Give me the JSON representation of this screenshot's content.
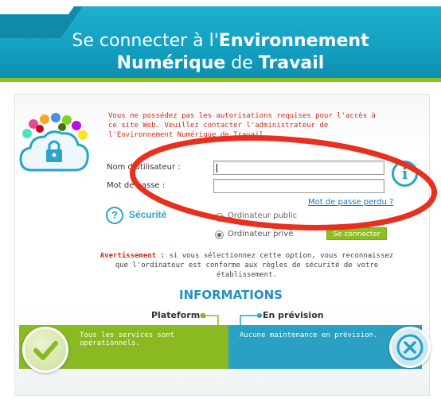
{
  "header": {
    "title_line1_plain": "Se connecter à l'",
    "title_line1_bold": "Environnement",
    "title_line2_bold1": "Numérique",
    "title_line2_plain": " de ",
    "title_line2_bold2": "Travail"
  },
  "warning": {
    "text": "Vous ne possédez pas les autorisations requises pour l'accès à ce site Web. Veuillez contacter l'administrateur de l'Environnement Numérique de Travail."
  },
  "login": {
    "username_label": "Nom d'utilisateur :",
    "username_value": "",
    "password_label": "Mot de passe :",
    "password_value": "",
    "forgot_link": "Mot de passe perdu ?"
  },
  "security": {
    "label": "Sécurité",
    "options": [
      {
        "label": "Ordinateur public",
        "checked": false
      },
      {
        "label": "Ordinateur privé",
        "checked": true
      }
    ],
    "connect_button": "Se connecter",
    "notice_highlight": "Avertissement :",
    "notice_text": " si vous sélectionnez cette option, vous reconnaissez que l'ordinateur est conforme aux règles de sécurité de votre établissement."
  },
  "informations": {
    "title": "INFORMATIONS",
    "platform_label": "Plateforme",
    "forecast_label": "En prévision",
    "platform_status": "Tous les services sont opérationnels.",
    "forecast_status": "Aucune maintenance en prévision."
  },
  "colors": {
    "brand_blue": "#1fb0cf",
    "brand_green": "#8cbf1f",
    "warning_red": "#d42a1c",
    "annotation_red": "#e8301f"
  },
  "icons": [
    "cloud-lock-icon",
    "info-icon",
    "help-icon",
    "check-icon",
    "close-icon"
  ]
}
